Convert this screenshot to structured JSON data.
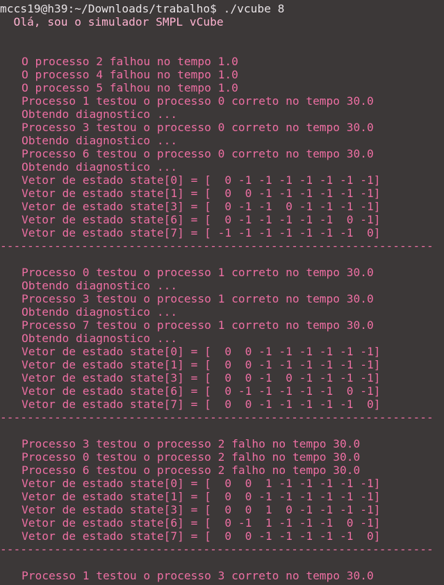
{
  "terminal": {
    "prompt": "mccs19@h39:~/Downloads/trabalho$ ./vcube 8",
    "intro": "  Olá, sou o simulador SMPL vCube",
    "blank1": "",
    "blank2": "",
    "separator": "----------------------------------------------------------------",
    "block1": [
      "O processo 2 falhou no tempo 1.0",
      "O processo 4 falhou no tempo 1.0",
      "O processo 5 falhou no tempo 1.0",
      "Processo 1 testou o processo 0 correto no tempo 30.0",
      "Obtendo diagnostico ...",
      "Processo 3 testou o processo 0 correto no tempo 30.0",
      "Obtendo diagnostico ...",
      "Processo 6 testou o processo 0 correto no tempo 30.0",
      "Obtendo diagnostico ...",
      "Vetor de estado state[0] = [  0 -1 -1 -1 -1 -1 -1 -1]",
      "Vetor de estado state[1] = [  0  0 -1 -1 -1 -1 -1 -1]",
      "Vetor de estado state[3] = [  0 -1 -1  0 -1 -1 -1 -1]",
      "Vetor de estado state[6] = [  0 -1 -1 -1 -1 -1  0 -1]",
      "Vetor de estado state[7] = [ -1 -1 -1 -1 -1 -1 -1  0]"
    ],
    "block2": [
      "Processo 0 testou o processo 1 correto no tempo 30.0",
      "Obtendo diagnostico ...",
      "Processo 3 testou o processo 1 correto no tempo 30.0",
      "Obtendo diagnostico ...",
      "Processo 7 testou o processo 1 correto no tempo 30.0",
      "Obtendo diagnostico ...",
      "Vetor de estado state[0] = [  0  0 -1 -1 -1 -1 -1 -1]",
      "Vetor de estado state[1] = [  0  0 -1 -1 -1 -1 -1 -1]",
      "Vetor de estado state[3] = [  0  0 -1  0 -1 -1 -1 -1]",
      "Vetor de estado state[6] = [  0 -1 -1 -1 -1 -1  0 -1]",
      "Vetor de estado state[7] = [  0  0 -1 -1 -1 -1 -1  0]"
    ],
    "block3": [
      "Processo 3 testou o processo 2 falho no tempo 30.0",
      "Processo 0 testou o processo 2 falho no tempo 30.0",
      "Processo 6 testou o processo 2 falho no tempo 30.0",
      "Vetor de estado state[0] = [  0  0  1 -1 -1 -1 -1 -1]",
      "Vetor de estado state[1] = [  0  0 -1 -1 -1 -1 -1 -1]",
      "Vetor de estado state[3] = [  0  0  1  0 -1 -1 -1 -1]",
      "Vetor de estado state[6] = [  0 -1  1 -1 -1 -1  0 -1]",
      "Vetor de estado state[7] = [  0  0 -1 -1 -1 -1 -1  0]"
    ],
    "block4": [
      "Processo 1 testou o processo 3 correto no tempo 30.0"
    ]
  },
  "colors": {
    "background": "#3c3838",
    "output": "#ee6fa3",
    "prompt": "#e8e3e6"
  }
}
